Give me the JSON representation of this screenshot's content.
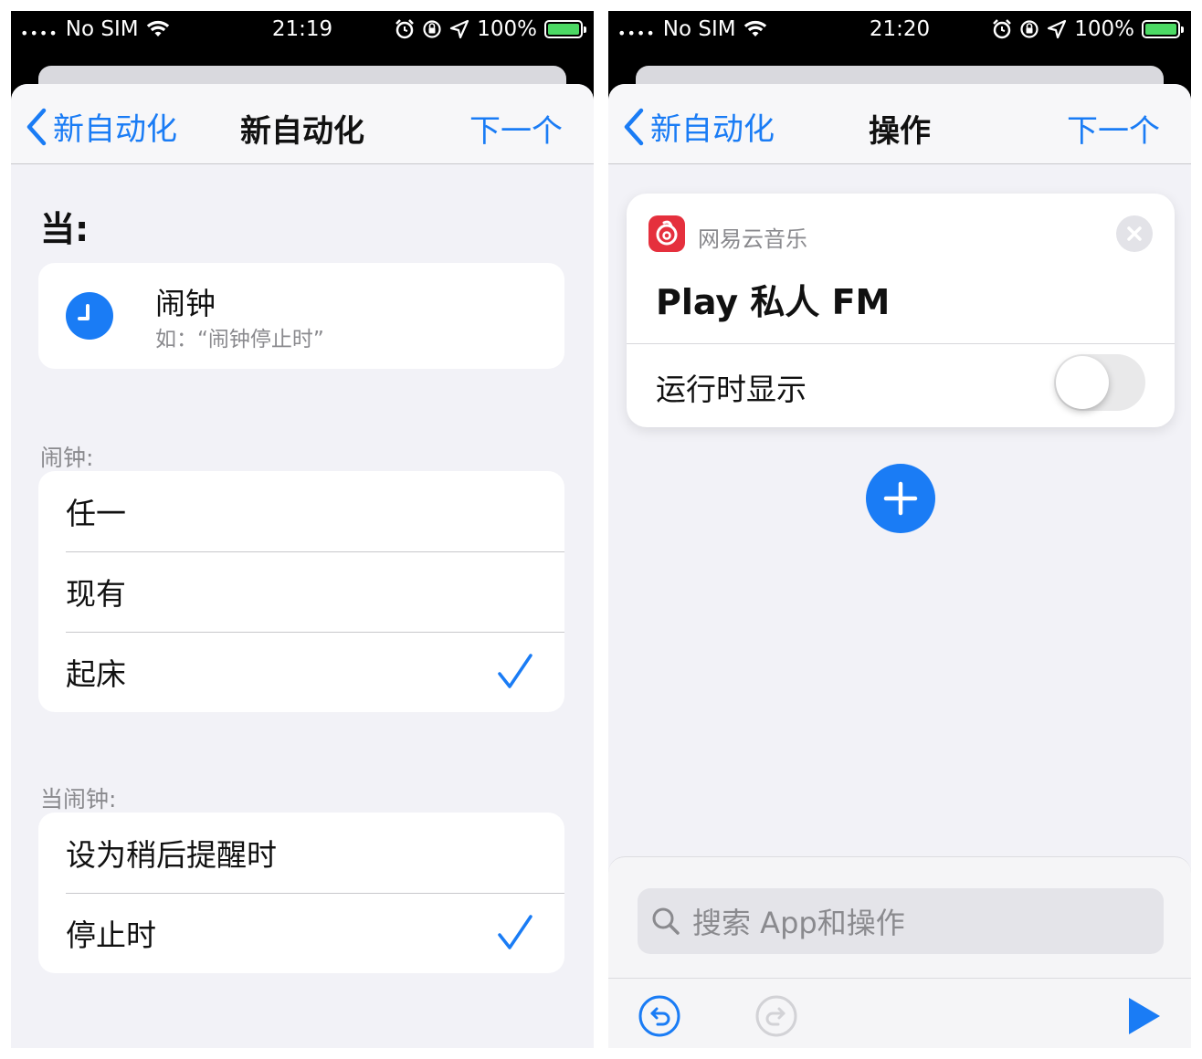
{
  "left": {
    "status": {
      "carrier": "No SIM",
      "time": "21:19",
      "battery": "100%"
    },
    "nav": {
      "back_label": "新自动化",
      "title": "新自动化",
      "next_label": "下一个"
    },
    "when_heading": "当:",
    "trigger": {
      "title": "闹钟",
      "subtitle": "如：“闹钟停止时”"
    },
    "alarm_section": {
      "heading": "闹钟:",
      "options": [
        "任一",
        "现有",
        "起床"
      ],
      "selected": "起床"
    },
    "event_section": {
      "heading": "当闹钟:",
      "options": [
        "设为稍后提醒时",
        "停止时"
      ],
      "selected": "停止时"
    }
  },
  "right": {
    "status": {
      "carrier": "No SIM",
      "time": "21:20",
      "battery": "100%"
    },
    "nav": {
      "back_label": "新自动化",
      "title": "操作",
      "next_label": "下一个"
    },
    "action": {
      "app_name": "网易云音乐",
      "title": "Play 私人 FM",
      "show_when_run_label": "运行时显示",
      "show_when_run": false
    },
    "search": {
      "placeholder": "搜索 App和操作"
    },
    "colors": {
      "accent": "#1a7cf5",
      "app_icon": "#e5303d",
      "battery": "#4cd964"
    },
    "icons": [
      "undo-icon",
      "redo-icon",
      "play-icon",
      "plus-icon",
      "close-icon",
      "search-icon"
    ]
  }
}
